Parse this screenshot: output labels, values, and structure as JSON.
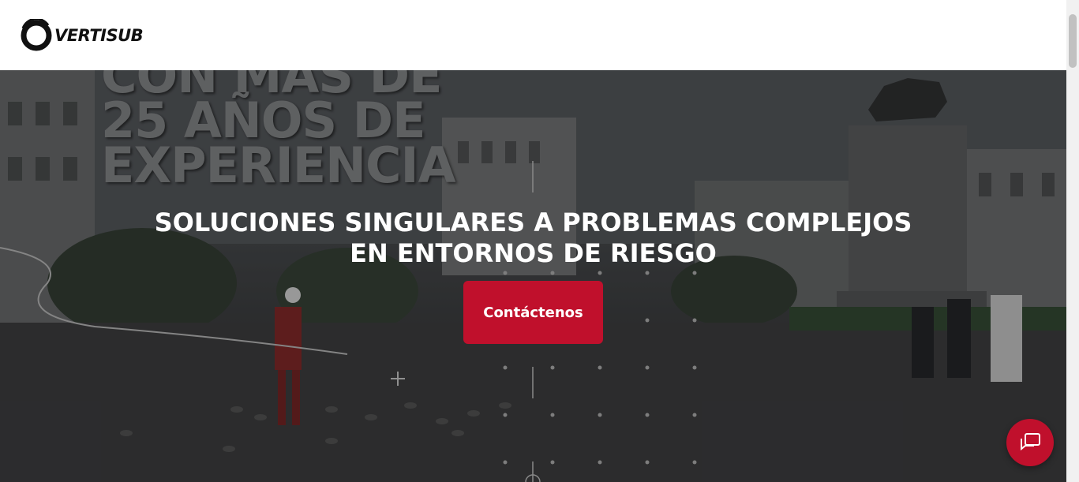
{
  "header": {
    "logo_text": "VERTISUB"
  },
  "hero": {
    "background_slogan": [
      "CON MÁS DE",
      "25 AÑOS DE",
      "EXPERIENCIA"
    ],
    "title": "SOLUCIONES SINGULARES A PROBLEMAS COMPLEJOS EN ENTORNOS DE RIESGO",
    "cta_label": "Contáctenos"
  },
  "chat": {
    "icon": "chat-icon"
  },
  "colors": {
    "brand_red": "#c0102c",
    "header_bg": "#ffffff",
    "title_text": "#ffffff"
  }
}
